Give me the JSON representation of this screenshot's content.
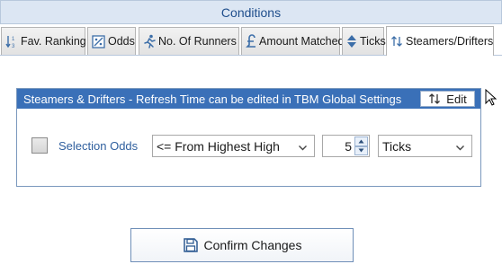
{
  "window": {
    "title": "Conditions"
  },
  "tabs": [
    {
      "label": "Fav. Ranking",
      "icon": "sort-numeric-icon"
    },
    {
      "label": "Odds",
      "icon": "odds-icon"
    },
    {
      "label": "No. Of Runners",
      "icon": "runner-icon"
    },
    {
      "label": "Amount Matched",
      "icon": "pound-icon"
    },
    {
      "label": "Ticks",
      "icon": "up-down-icon"
    },
    {
      "label": "Steamers/Drifters",
      "icon": "updown-arrows-icon",
      "active": true
    }
  ],
  "panel": {
    "header": "Steamers & Drifters - Refresh Time can be edited in TBM Global Settings",
    "edit_label": "Edit"
  },
  "row": {
    "checkbox_checked": false,
    "label": "Selection Odds",
    "source_select": "<= From Highest High",
    "ticks_value": "5",
    "unit_select": "Ticks"
  },
  "confirm_label": "Confirm Changes",
  "colors": {
    "accent": "#3a70b8",
    "title_text": "#1f4e8c",
    "label_blue": "#2f5f9e"
  }
}
